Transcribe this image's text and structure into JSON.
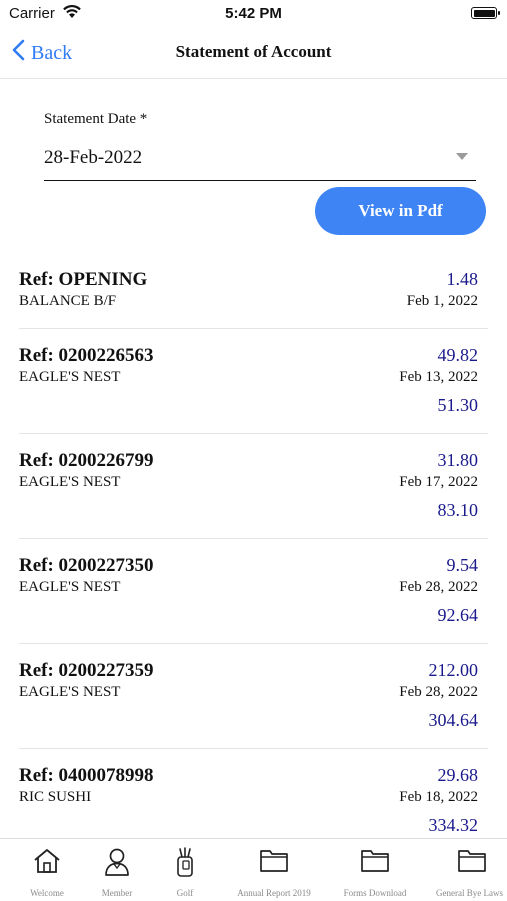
{
  "status_bar": {
    "carrier": "Carrier",
    "time": "5:42 PM"
  },
  "nav": {
    "back_label": "Back",
    "title": "Statement of Account"
  },
  "form": {
    "date_label": "Statement Date *",
    "date_value": "28-Feb-2022",
    "pdf_button": "View in Pdf"
  },
  "colors": {
    "accent": "#3e84f5",
    "link": "#2f7cf6",
    "amount": "#1a1a8c"
  },
  "transactions": [
    {
      "ref": "Ref: OPENING",
      "desc": "BALANCE B/F",
      "amount": "1.48",
      "date": "Feb 1, 2022",
      "balance": ""
    },
    {
      "ref": "Ref: 0200226563",
      "desc": "EAGLE'S NEST",
      "amount": "49.82",
      "date": "Feb 13, 2022",
      "balance": "51.30"
    },
    {
      "ref": "Ref: 0200226799",
      "desc": "EAGLE'S NEST",
      "amount": "31.80",
      "date": "Feb 17, 2022",
      "balance": "83.10"
    },
    {
      "ref": "Ref: 0200227350",
      "desc": "EAGLE'S NEST",
      "amount": "9.54",
      "date": "Feb 28, 2022",
      "balance": "92.64"
    },
    {
      "ref": "Ref: 0200227359",
      "desc": "EAGLE'S NEST",
      "amount": "212.00",
      "date": "Feb 28, 2022",
      "balance": "304.64"
    },
    {
      "ref": "Ref: 0400078998",
      "desc": "RIC SUSHI",
      "amount": "29.68",
      "date": "Feb 18, 2022",
      "balance": "334.32"
    }
  ],
  "tabs": [
    {
      "label": "Welcome",
      "icon": "home-icon"
    },
    {
      "label": "Member",
      "icon": "person-icon"
    },
    {
      "label": "Golf",
      "icon": "golf-bag-icon"
    },
    {
      "label": "Annual Report 2019",
      "icon": "folder-icon"
    },
    {
      "label": "Forms Download",
      "icon": "folder-icon"
    },
    {
      "label": "General Bye Laws",
      "icon": "folder-icon"
    }
  ]
}
